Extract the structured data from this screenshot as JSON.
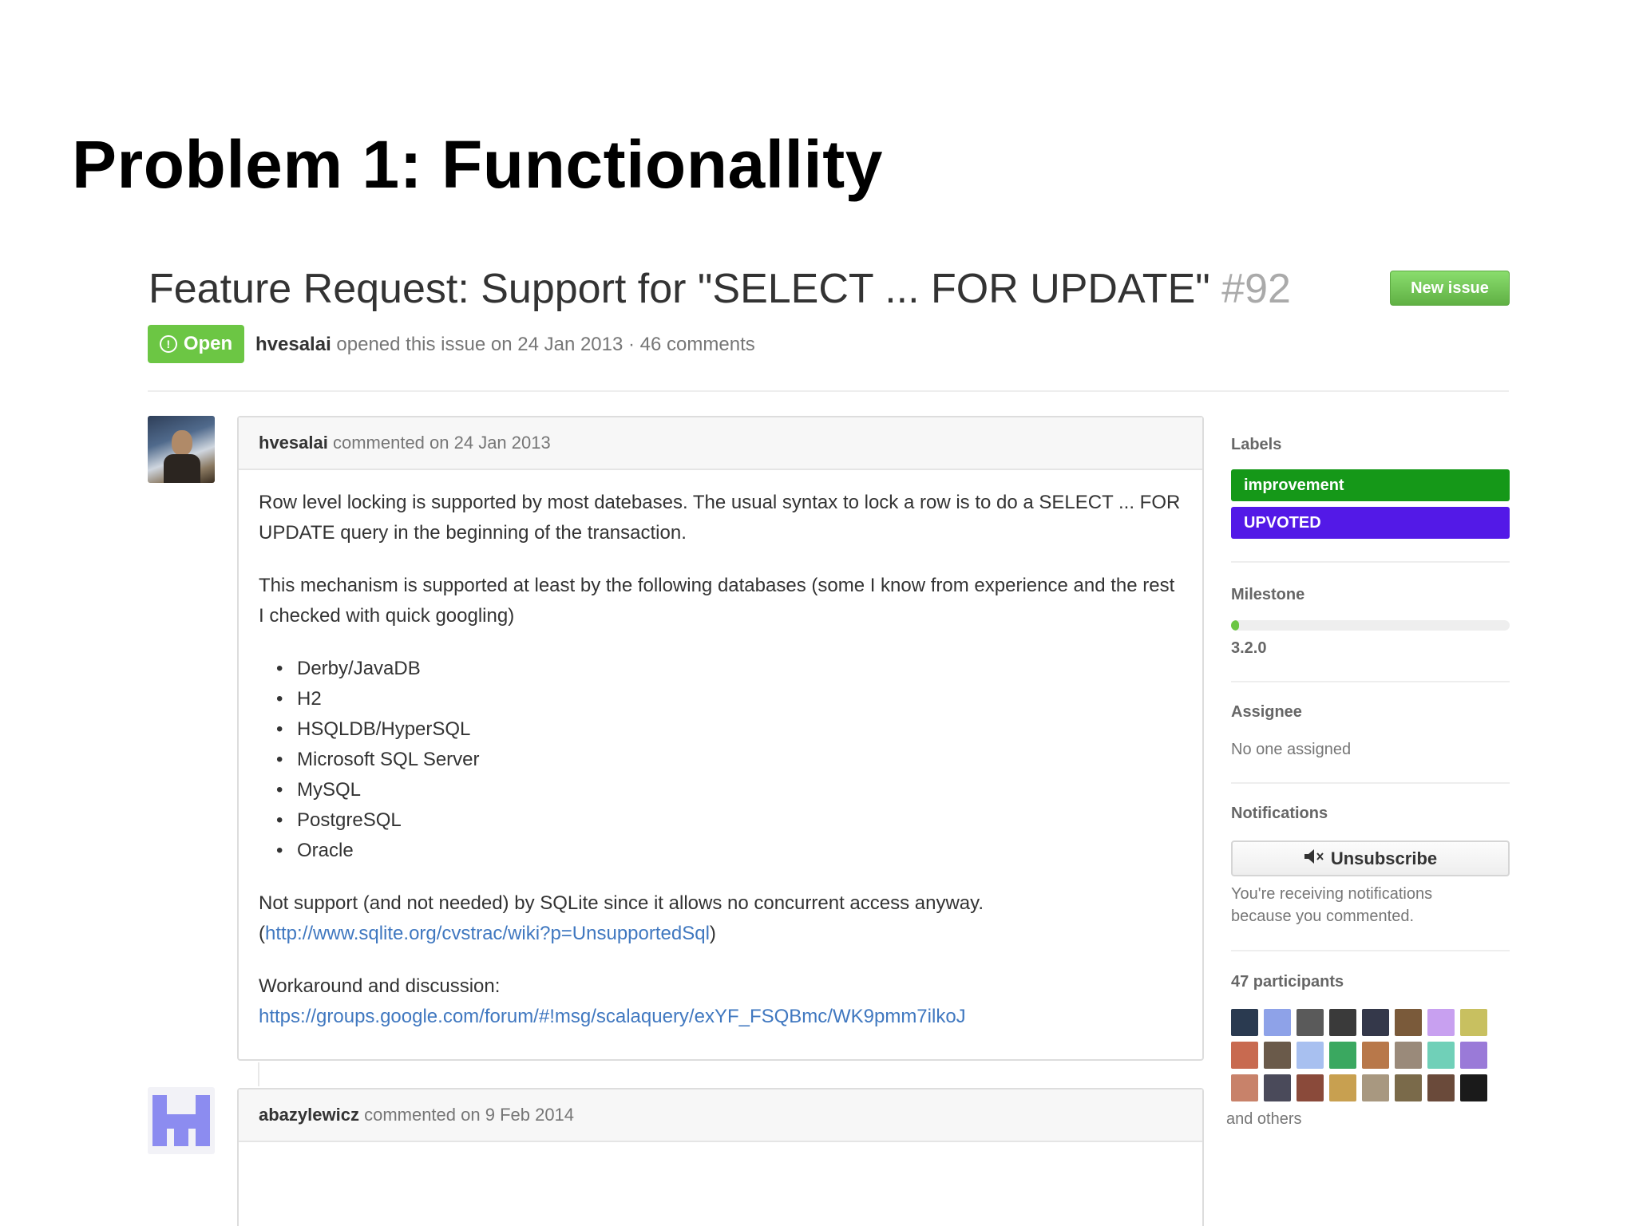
{
  "slide": {
    "title": "Problem 1: Functionallity"
  },
  "issue": {
    "title": "Feature Request: Support for \"SELECT ... FOR UPDATE\"",
    "number": "#92",
    "state": "Open",
    "author": "hvesalai",
    "meta_text": "opened this issue on 24 Jan 2013 · 46 comments",
    "new_issue_label": "New issue"
  },
  "comments": [
    {
      "author": "hvesalai",
      "date_text": "commented on 24 Jan 2013",
      "paragraph_1": "Row level locking is supported by most datebases. The usual syntax to lock a row is to do a SELECT ... FOR UPDATE query in the beginning of the transaction.",
      "paragraph_2": "This mechanism is supported at least by the following databases (some I know from experience and the rest I checked with quick googling)",
      "databases": [
        "Derby/JavaDB",
        "H2",
        "HSQLDB/HyperSQL",
        "Microsoft SQL Server",
        "MySQL",
        "PostgreSQL",
        "Oracle"
      ],
      "paragraph_3": "Not support (and not needed) by SQLite since it allows no concurrent access anyway.",
      "link_1": "http://www.sqlite.org/cvstrac/wiki?p=UnsupportedSql",
      "paragraph_4": "Workaround and discussion:",
      "link_2": "https://groups.google.com/forum/#!msg/scalaquery/exYF_FSQBmc/WK9pmm7ilkoJ"
    },
    {
      "author": "abazylewicz",
      "date_text": "commented on 9 Feb 2014"
    }
  ],
  "sidebar": {
    "labels_heading": "Labels",
    "labels": [
      {
        "name": "improvement",
        "color": "#159818"
      },
      {
        "name": "UPVOTED",
        "color": "#5319e7"
      }
    ],
    "milestone_heading": "Milestone",
    "milestone_name": "3.2.0",
    "milestone_progress": 0.03,
    "assignee_heading": "Assignee",
    "assignee_text": "No one assigned",
    "notifications_heading": "Notifications",
    "unsubscribe_label": "Unsubscribe",
    "notification_reason": "You're receiving notifications because you commented.",
    "participants_heading": "47 participants",
    "participant_colors": [
      "#2a3a50",
      "#8ea2e8",
      "#5a5a5a",
      "#3a3a3a",
      "#34384a",
      "#7a5a3a",
      "#c8a0f0",
      "#c8c060",
      "#c86a50",
      "#6a5a4a",
      "#a8c0f0",
      "#3aa860",
      "#b8784a",
      "#9a8a7a",
      "#70d0b8",
      "#9a7ad8",
      "#c8826a",
      "#4a4a5a",
      "#8a4a3a",
      "#c8a050",
      "#a89880",
      "#7a6a4a",
      "#6a4a3a",
      "#1a1a1a"
    ],
    "and_others": "and others"
  }
}
